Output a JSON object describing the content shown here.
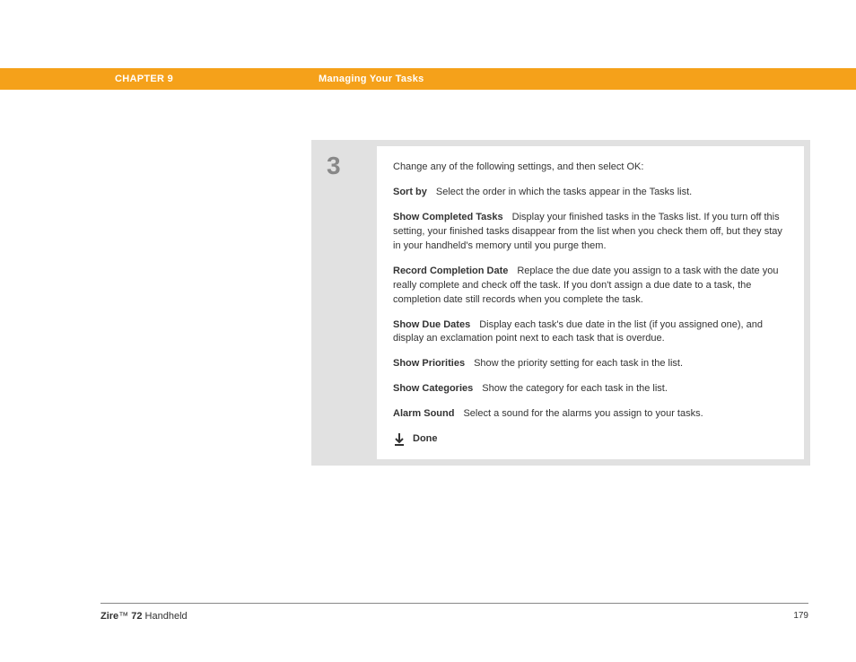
{
  "header": {
    "chapter_label": "CHAPTER 9",
    "chapter_title": "Managing Your Tasks"
  },
  "step": {
    "number": "3",
    "intro": "Change any of the following settings, and then select OK:",
    "options": [
      {
        "label": "Sort by",
        "desc": "Select the order in which the tasks appear in the Tasks list."
      },
      {
        "label": "Show Completed Tasks",
        "desc": "Display your finished tasks in the Tasks list. If you turn off this setting, your finished tasks disappear from the list when you check them off, but they stay in your handheld's memory until you purge them."
      },
      {
        "label": "Record Completion Date",
        "desc": "Replace the due date you assign to a task with the date you really complete and check off the task. If you don't assign a due date to a task, the completion date still records when you complete the task."
      },
      {
        "label": "Show Due Dates",
        "desc": "Display each task's due date in the list (if you assigned one), and display an exclamation point next to each task that is overdue."
      },
      {
        "label": "Show Priorities",
        "desc": "Show the priority setting for each task in the list."
      },
      {
        "label": "Show Categories",
        "desc": "Show the category for each task in the list."
      },
      {
        "label": "Alarm Sound",
        "desc": "Select a sound for the alarms you assign to your tasks."
      }
    ],
    "done_label": "Done"
  },
  "footer": {
    "brand": "Zire",
    "tm": "™",
    "model": " 72",
    "product_suffix": " Handheld",
    "page_number": "179"
  }
}
